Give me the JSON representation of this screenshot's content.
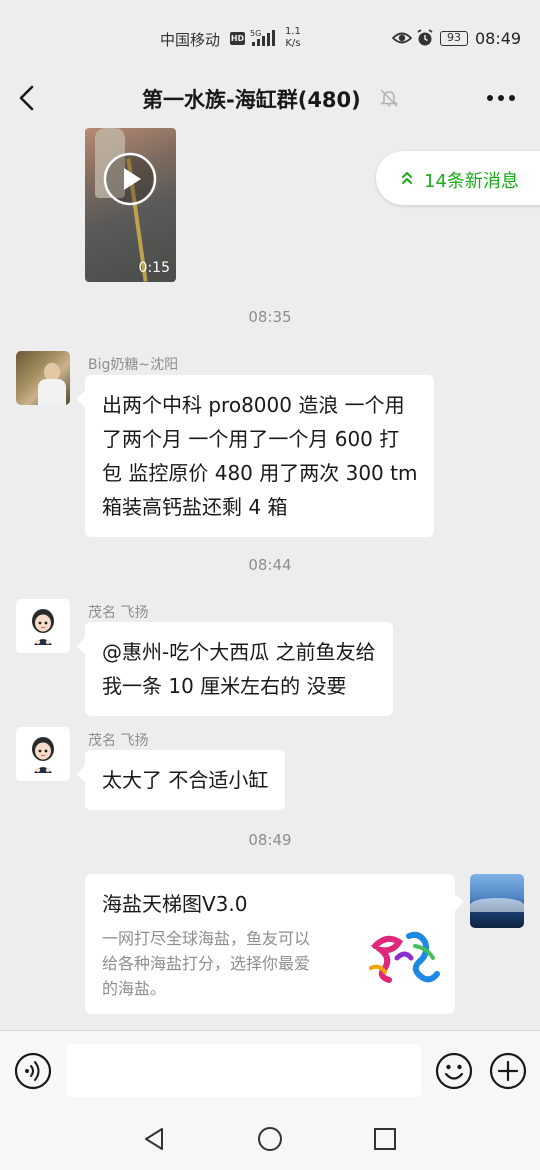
{
  "status_bar": {
    "carrier": "中国移动",
    "hd": "HD",
    "network": "5G",
    "speed_value": "1.1",
    "speed_unit": "K/s",
    "battery": "93",
    "time": "08:49"
  },
  "header": {
    "title": "第一水族-海缸群(480)"
  },
  "chat": {
    "video": {
      "duration": "0:15"
    },
    "new_messages_label": "14条新消息",
    "timestamps": [
      "08:35",
      "08:44",
      "08:49"
    ],
    "messages": [
      {
        "sender": "Big奶糖~沈阳",
        "lines": [
          "出两个中科 pro8000 造浪 一个用",
          "了两个月 一个用了一个月 600 打",
          "包 监控原价 480 用了两次 300  tm",
          "箱装高钙盐还剩 4 箱"
        ]
      },
      {
        "sender": "茂名 飞扬",
        "lines": [
          "@惠州-吃个大西瓜    之前鱼友给",
          "我一条  10 厘米左右的 没要"
        ]
      },
      {
        "sender": "茂名 飞扬",
        "lines": [
          "太大了 不合适小缸"
        ]
      }
    ],
    "card": {
      "title": "海盐天梯图V3.0",
      "desc_lines": [
        "一网打尽全球海盐，鱼友可以",
        "给各种海盐打分，选择你最爱",
        "的海盐。"
      ]
    }
  },
  "input_bar": {
    "placeholder": ""
  },
  "colors": {
    "accent_green": "#1aad19",
    "background": "#ededed"
  }
}
